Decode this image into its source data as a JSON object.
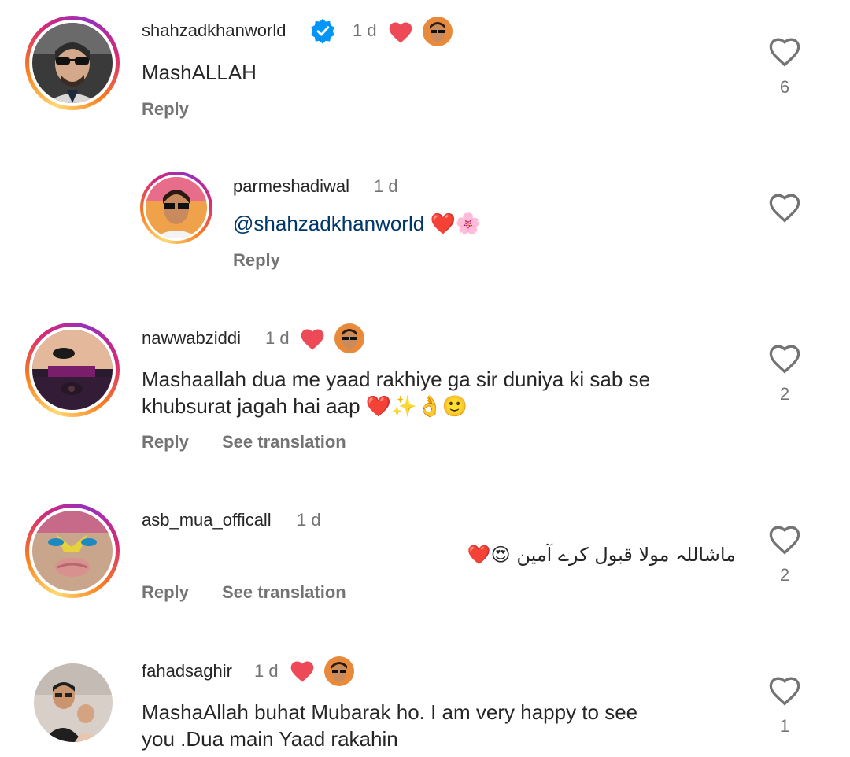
{
  "comments": [
    {
      "username": "shahzadkhanworld",
      "time": "1 d",
      "text": "MashALLAH",
      "reply": "Reply",
      "likes": "6",
      "verified": true,
      "author_liked": true
    },
    {
      "username": "parmeshadiwal",
      "time": "1 d",
      "mention": "@shahzadkhanworld",
      "text_suffix": "❤️🌸",
      "reply": "Reply"
    },
    {
      "username": "nawwabziddi",
      "time": "1 d",
      "text_line1": "Mashaallah dua me yaad rakhiye ga sir duniya ki sab se",
      "text_line2": "khubsurat jagah hai aap ❤️✨👌🙂",
      "reply": "Reply",
      "translate": "See translation",
      "likes": "2",
      "author_liked": true
    },
    {
      "username": "asb_mua_officall",
      "time": "1 d",
      "text": "ماشاللہ مولا قبول کرے آمین 😍❤️",
      "reply": "Reply",
      "translate": "See translation",
      "likes": "2"
    },
    {
      "username": "fahadsaghir",
      "time": "1 d",
      "text_line1": "MashaAllah buhat Mubarak ho. I am very happy to see",
      "text_line2": "you .Dua main Yaad rakahin",
      "likes": "1",
      "author_liked": true
    }
  ],
  "colors": {
    "heart_red": "#ed4956",
    "verified_blue": "#0095f6",
    "muted": "#737373",
    "mention": "#00376b"
  },
  "icons": [
    "heart-outline-icon",
    "red-heart-icon",
    "verified-badge-icon"
  ]
}
